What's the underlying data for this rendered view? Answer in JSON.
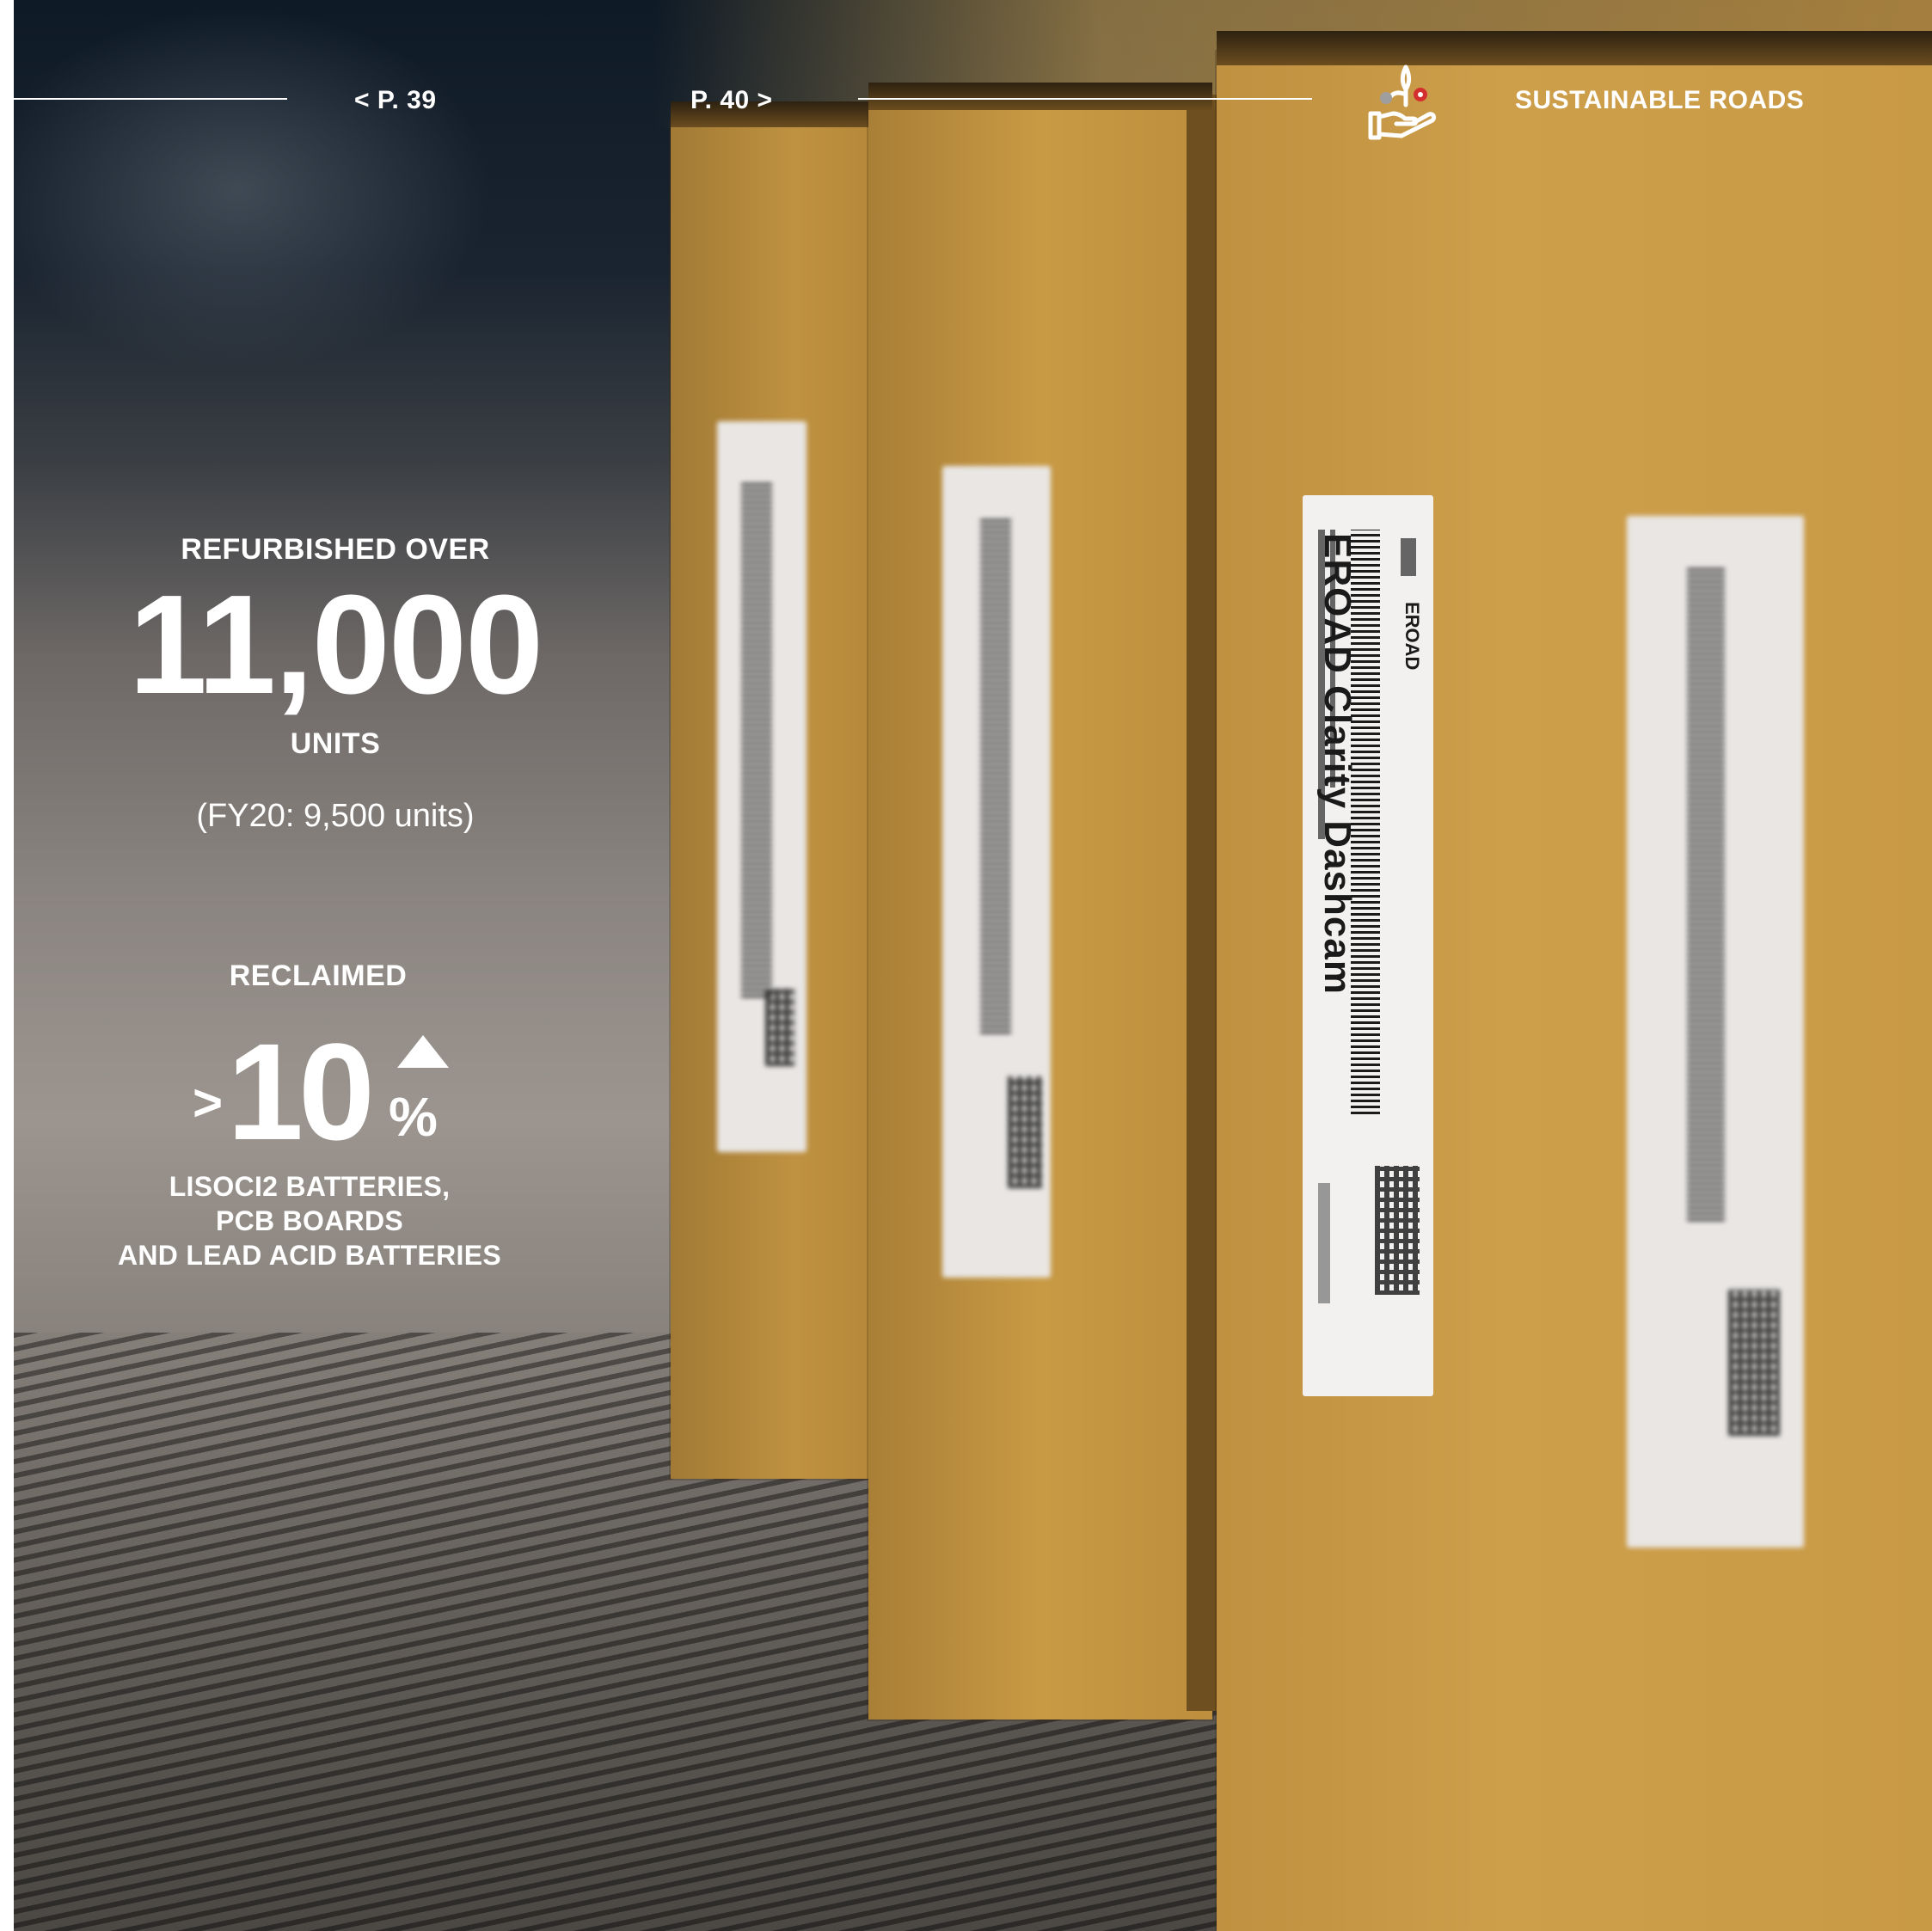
{
  "header": {
    "prev_page": "< P. 39",
    "next_page": "P. 40 >",
    "section_title": "SUSTAINABLE ROADS",
    "logo_icon": "hand-plant-gear-icon"
  },
  "stats": {
    "refurbished": {
      "label": "REFURBISHED OVER",
      "value": "11,000",
      "unit": "UNITS",
      "comparison": "(FY20: 9,500 units)"
    },
    "reclaimed": {
      "label": "RECLAIMED",
      "prefix": ">",
      "value": "10",
      "suffix": "%",
      "trend_icon": "up-triangle-icon",
      "items": [
        "LISOCI2 BATTERIES,",
        "PCB BOARDS",
        "AND LEAD ACID BATTERIES"
      ]
    }
  },
  "photo": {
    "label_product": "EROAD Clarity Dashcam",
    "label_brand": "EROAD"
  },
  "colors": {
    "text": "#ffffff",
    "box": "#c99a46",
    "accent_red": "#d32f2f"
  }
}
